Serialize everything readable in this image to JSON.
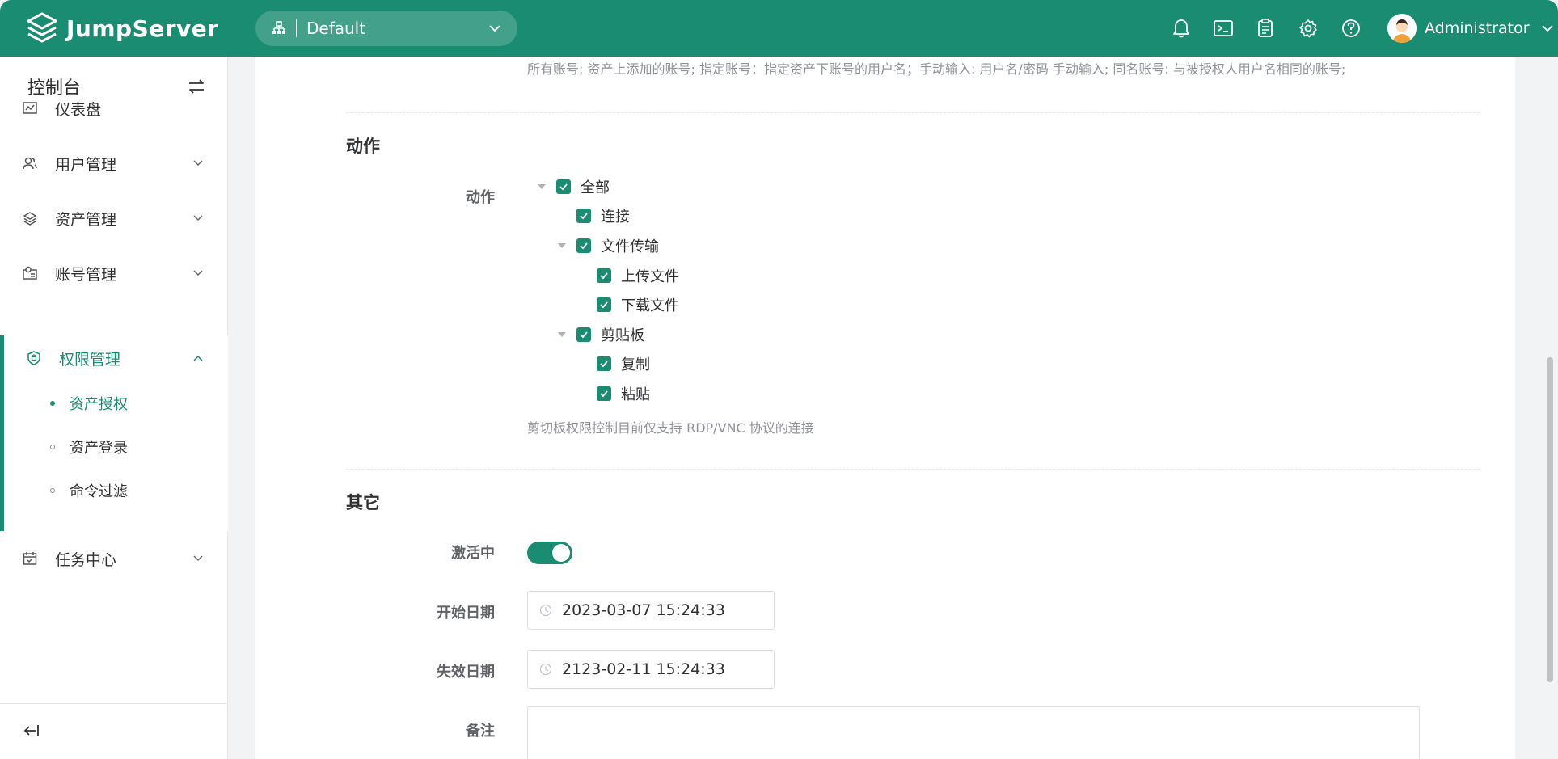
{
  "header": {
    "brand": "JumpServer",
    "org_label": "Default",
    "user_name": "Administrator"
  },
  "sidebar": {
    "title": "控制台",
    "items": [
      {
        "label": "仪表盘"
      },
      {
        "label": "用户管理"
      },
      {
        "label": "资产管理"
      },
      {
        "label": "账号管理"
      },
      {
        "label": "权限管理"
      },
      {
        "label": "任务中心"
      }
    ],
    "sub_items": [
      {
        "label": "资产授权"
      },
      {
        "label": "资产登录"
      },
      {
        "label": "命令过滤"
      }
    ]
  },
  "form": {
    "accounts_hint": "所有账号: 资产上添加的账号; 指定账号：指定资产下账号的用户名；手动输入: 用户名/密码 手动输入; 同名账号: 与被授权人用户名相同的账号;",
    "section_actions": "动作",
    "actions_label": "动作",
    "tree": {
      "all": "全部",
      "connect": "连接",
      "file_transfer": "文件传输",
      "upload": "上传文件",
      "download": "下载文件",
      "clipboard": "剪贴板",
      "copy": "复制",
      "paste": "粘贴"
    },
    "clipboard_hint": "剪切板权限控制目前仅支持 RDP/VNC 协议的连接",
    "section_other": "其它",
    "active_label": "激活中",
    "start_date_label": "开始日期",
    "start_date_value": "2023-03-07 15:24:33",
    "expire_date_label": "失效日期",
    "expire_date_value": "2123-02-11 15:24:33",
    "comment_label": "备注"
  },
  "colors": {
    "accent": "#1a8c72"
  }
}
